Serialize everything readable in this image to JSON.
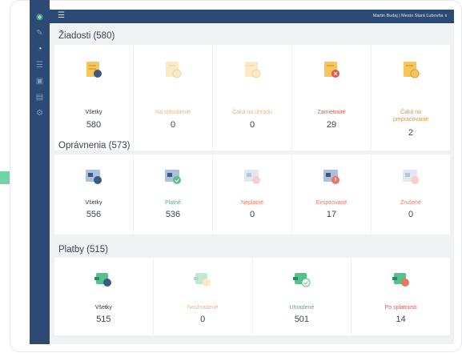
{
  "topbar": {
    "menu_icon": "menu-expand-icon",
    "user": "Martin Budaj | Mesto Stará Ľubovňa ∨"
  },
  "sidebar": {
    "icons": [
      "logo-icon",
      "edit-icon",
      "dashboard-icon",
      "list-icon",
      "briefcase-icon",
      "wallet-icon",
      "gear-icon"
    ]
  },
  "sections": {
    "ziadosti": {
      "title": "Žiadosti (580)",
      "cells": [
        {
          "label": "Všetky",
          "value": "580"
        },
        {
          "label": "Na schválenie",
          "value": "0"
        },
        {
          "label": "Čaká na úhradu",
          "value": "0"
        },
        {
          "label": "Zamietnuté",
          "value": "29"
        },
        {
          "label_1": "Čaká na",
          "label_2": "prepracovanie",
          "value": "2"
        }
      ]
    },
    "opravnenia": {
      "title": "Oprávnenia (573)",
      "cells": [
        {
          "label": "Všetky",
          "value": "556"
        },
        {
          "label": "Platné",
          "value": "536"
        },
        {
          "label": "Neplatné",
          "value": "0"
        },
        {
          "label": "Exspirované",
          "value": "17"
        },
        {
          "label": "Zrušené",
          "value": "0"
        }
      ]
    },
    "platby": {
      "title": "Platby (515)",
      "cells": [
        {
          "label": "Všetky",
          "value": "515"
        },
        {
          "label": "Neuhradené",
          "value": "0"
        },
        {
          "label": "Uhradené",
          "value": "501"
        },
        {
          "label": "Po splatnosti",
          "value": "14"
        }
      ]
    }
  },
  "colors": {
    "sidebar": "#2c4a74",
    "accent_green": "#58c08d",
    "orange": "#e6952a",
    "red": "#e2574c"
  }
}
